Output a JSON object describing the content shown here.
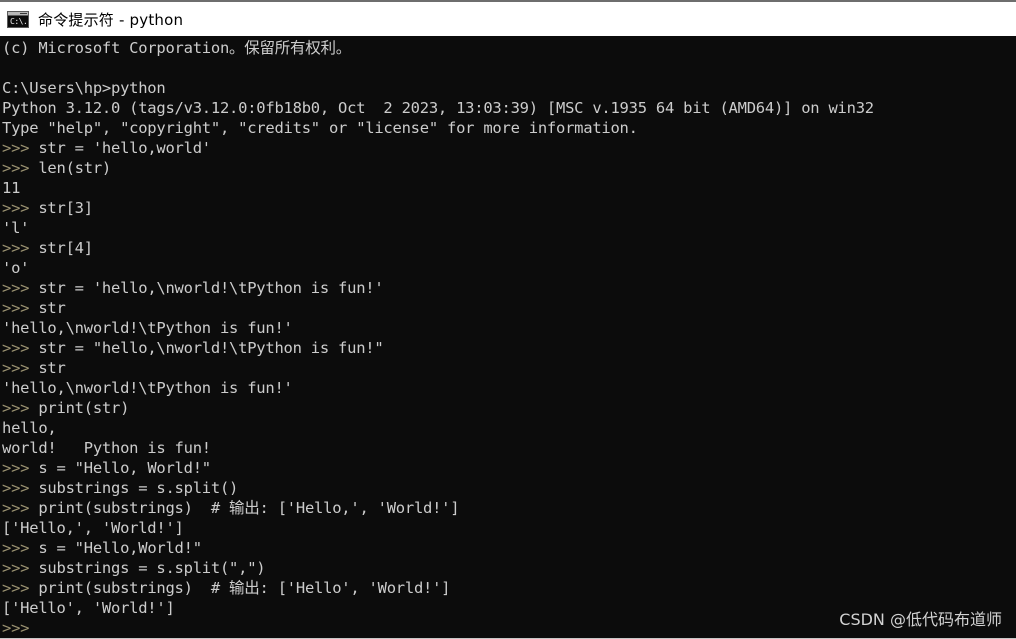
{
  "window": {
    "title": "命令提示符 - python",
    "icon": "console-icon",
    "icon_glyph": "C:\\.",
    "background_color": "#0c0c0c",
    "titlebar_background": "#ffffff",
    "text_color": "#cccccc",
    "prompt_color": "#9a9170"
  },
  "console": {
    "prompt": ">>>",
    "lines": [
      {
        "type": "output",
        "text": "(c) Microsoft Corporation。保留所有权利。"
      },
      {
        "type": "blank",
        "text": ""
      },
      {
        "type": "output",
        "text": "C:\\Users\\hp>python"
      },
      {
        "type": "output",
        "text": "Python 3.12.0 (tags/v3.12.0:0fb18b0, Oct  2 2023, 13:03:39) [MSC v.1935 64 bit (AMD64)] on win32"
      },
      {
        "type": "output",
        "text": "Type \"help\", \"copyright\", \"credits\" or \"license\" for more information."
      },
      {
        "type": "input",
        "prompt": ">>>",
        "text": " str = 'hello,world'"
      },
      {
        "type": "input",
        "prompt": ">>>",
        "text": " len(str)"
      },
      {
        "type": "output",
        "text": "11"
      },
      {
        "type": "input",
        "prompt": ">>>",
        "text": " str[3]"
      },
      {
        "type": "output",
        "text": "'l'"
      },
      {
        "type": "input",
        "prompt": ">>>",
        "text": " str[4]"
      },
      {
        "type": "output",
        "text": "'o'"
      },
      {
        "type": "input",
        "prompt": ">>>",
        "text": " str = 'hello,\\nworld!\\tPython is fun!'"
      },
      {
        "type": "input",
        "prompt": ">>>",
        "text": " str"
      },
      {
        "type": "output",
        "text": "'hello,\\nworld!\\tPython is fun!'"
      },
      {
        "type": "input",
        "prompt": ">>>",
        "text": " str = \"hello,\\nworld!\\tPython is fun!\""
      },
      {
        "type": "input",
        "prompt": ">>>",
        "text": " str"
      },
      {
        "type": "output",
        "text": "'hello,\\nworld!\\tPython is fun!'"
      },
      {
        "type": "input",
        "prompt": ">>>",
        "text": " print(str)"
      },
      {
        "type": "output",
        "text": "hello,"
      },
      {
        "type": "output",
        "text": "world!   Python is fun!"
      },
      {
        "type": "input",
        "prompt": ">>>",
        "text": " s = \"Hello, World!\""
      },
      {
        "type": "input",
        "prompt": ">>>",
        "text": " substrings = s.split()"
      },
      {
        "type": "input",
        "prompt": ">>>",
        "text": " print(substrings)  # 输出: ['Hello,', 'World!']"
      },
      {
        "type": "output",
        "text": "['Hello,', 'World!']"
      },
      {
        "type": "input",
        "prompt": ">>>",
        "text": " s = \"Hello,World!\""
      },
      {
        "type": "input",
        "prompt": ">>>",
        "text": " substrings = s.split(\",\")"
      },
      {
        "type": "input",
        "prompt": ">>>",
        "text": " print(substrings)  # 输出: ['Hello', 'World!']"
      },
      {
        "type": "output",
        "text": "['Hello', 'World!']"
      },
      {
        "type": "input",
        "prompt": ">>>",
        "text": ""
      }
    ]
  },
  "watermark": {
    "text": "CSDN @低代码布道师"
  }
}
